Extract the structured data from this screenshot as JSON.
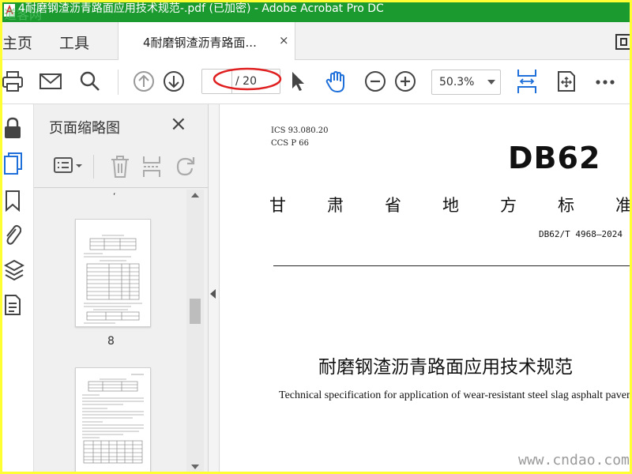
{
  "window": {
    "title": "4耐磨钢渣沥青路面应用技术规范-.pdf  (已加密)  - Adobe Acrobat Pro DC",
    "watermark_logo": "道客网",
    "frame_color": "#ffff33",
    "titlebar_color": "#1b9a2f"
  },
  "tabs": {
    "home": "主页",
    "tools": "工具",
    "document": "4耐磨钢渣沥青路面...",
    "close": "×"
  },
  "toolbar": {
    "icons": [
      "print-icon",
      "email-icon",
      "search-icon",
      "page-up-icon",
      "page-down-icon",
      "select-cursor-icon",
      "hand-icon",
      "zoom-out-icon",
      "zoom-in-icon",
      "fit-width-icon",
      "full-screen-icon",
      "more-icon"
    ],
    "page_input": "",
    "page_total": "/ 20",
    "zoom": "50.3%"
  },
  "left_rail": {
    "icons": [
      "lock-icon",
      "page-thumbnails-icon",
      "bookmark-icon",
      "attachment-icon",
      "layers-icon",
      "document-properties-icon"
    ]
  },
  "thumbnails_panel": {
    "title": "页面缩略图",
    "close": "×",
    "tools": [
      "thumbnail-options-icon",
      "delete-icon",
      "insert-icon",
      "rotate-icon"
    ],
    "pages": [
      {
        "label": "8"
      },
      {
        "label": ""
      }
    ],
    "scroll_position": 0.4
  },
  "document": {
    "ics": "ICS  93.080.20",
    "ccs": "CCS  P 66",
    "standard_logo": "DB62",
    "standard_type_chars": [
      "甘",
      "肃",
      "省",
      "地",
      "方",
      "标",
      "准"
    ],
    "standard_number": "DB62/T 4968—2024",
    "title_cn": "耐磨钢渣沥青路面应用技术规范",
    "title_en": "Technical specification for application of wear-resistant steel slag asphalt pavement",
    "site_watermark": "www.cndao.com"
  }
}
